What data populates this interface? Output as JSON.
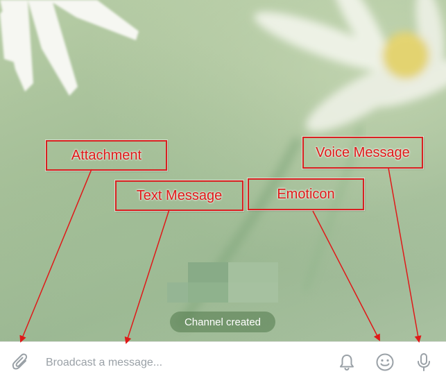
{
  "composer": {
    "placeholder": "Broadcast a message..."
  },
  "service_message": "Channel created",
  "annotations": {
    "attachment": "Attachment",
    "text_message": "Text Message",
    "emoticon": "Emoticon",
    "voice_message": "Voice Message"
  },
  "icons": {
    "attach": "paperclip-icon",
    "bell": "bell-icon",
    "emoji": "smiley-icon",
    "mic": "microphone-icon"
  },
  "colors": {
    "annotation_red": "#e01818",
    "icon_gray": "#9aa1a7"
  }
}
